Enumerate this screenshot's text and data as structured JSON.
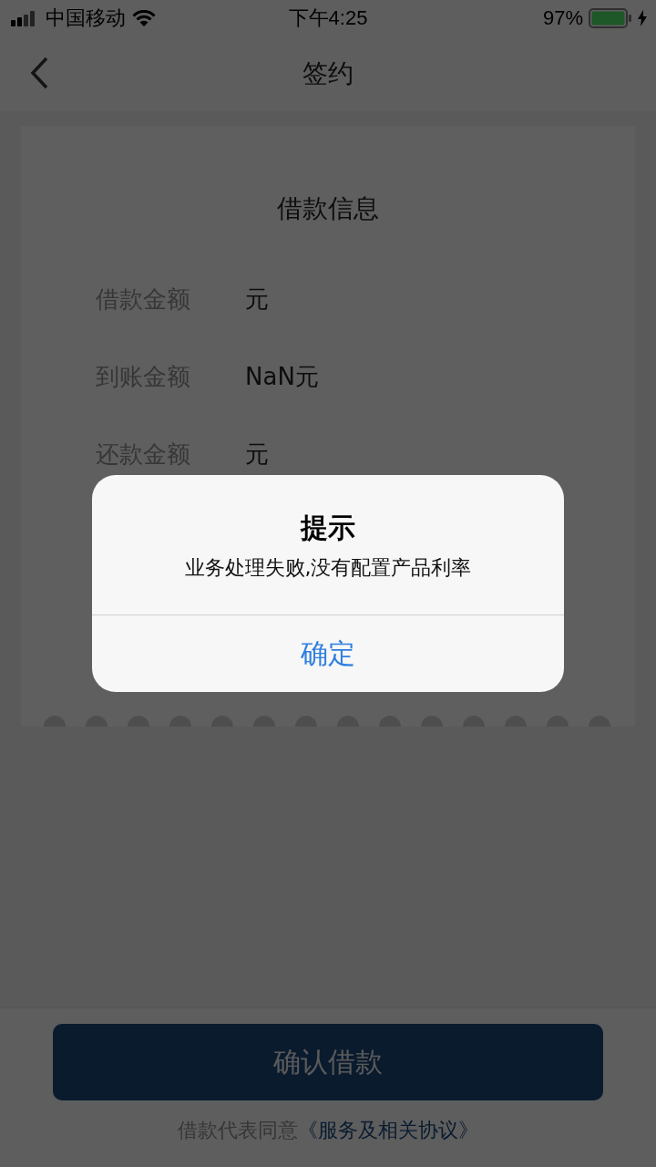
{
  "status_bar": {
    "carrier": "中国移动",
    "time": "下午4:25",
    "battery": "97%"
  },
  "nav": {
    "title": "签约"
  },
  "card": {
    "title": "借款信息",
    "rows": [
      {
        "label": "借款金额",
        "value": "元"
      },
      {
        "label": "到账金额",
        "value": "NaN元"
      },
      {
        "label": "还款金额",
        "value": "元"
      }
    ]
  },
  "confirm_button": "确认借款",
  "agreement": {
    "text": "借款代表同意",
    "link": "《服务及相关协议》"
  },
  "dialog": {
    "title": "提示",
    "message": "业务处理失败,没有配置产品利率",
    "button": "确定"
  }
}
